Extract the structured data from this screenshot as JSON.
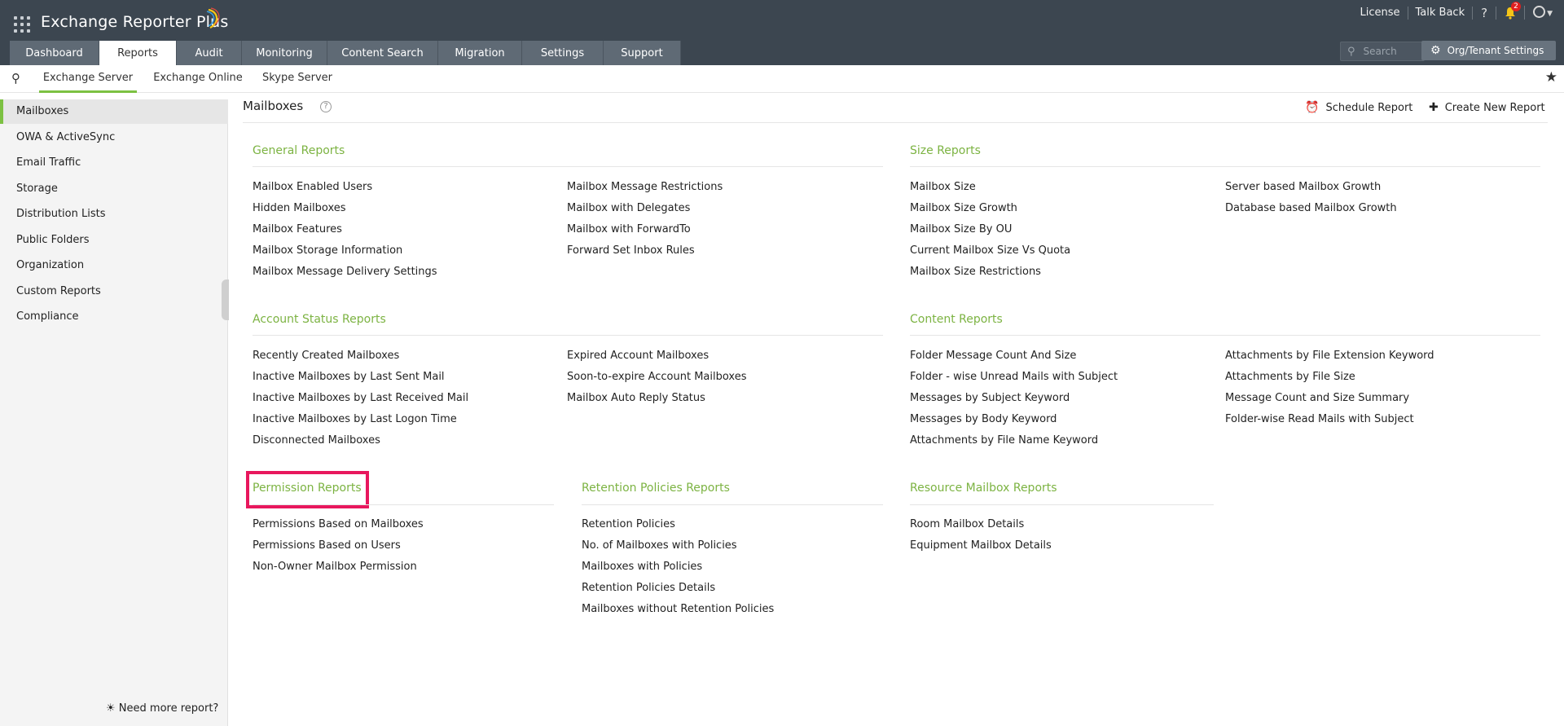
{
  "header": {
    "app_name": "Exchange Reporter Plus",
    "top_links": [
      "License",
      "Talk Back"
    ],
    "help_glyph": "?",
    "notification_count": "2",
    "tabs": [
      "Dashboard",
      "Reports",
      "Audit",
      "Monitoring",
      "Content Search",
      "Migration",
      "Settings",
      "Support"
    ],
    "active_tab": "Reports",
    "search_placeholder": "Search",
    "org_settings_label": "Org/Tenant Settings"
  },
  "subtabs": {
    "items": [
      "Exchange Server",
      "Exchange Online",
      "Skype Server"
    ],
    "active": "Exchange Server"
  },
  "sidebar": {
    "items": [
      "Mailboxes",
      "OWA & ActiveSync",
      "Email Traffic",
      "Storage",
      "Distribution Lists",
      "Public Folders",
      "Organization",
      "Custom Reports",
      "Compliance"
    ],
    "active": "Mailboxes",
    "footer": "Need more report?"
  },
  "content": {
    "title": "Mailboxes",
    "schedule_report": "Schedule Report",
    "create_new_report": "Create New Report",
    "sections": {
      "general": {
        "title": "General Reports",
        "col1": [
          "Mailbox Enabled Users",
          "Hidden Mailboxes",
          "Mailbox Features",
          "Mailbox Storage Information",
          "Mailbox Message Delivery Settings"
        ],
        "col2": [
          "Mailbox Message Restrictions",
          "Mailbox with Delegates",
          "Mailbox with ForwardTo",
          "Forward Set Inbox Rules"
        ]
      },
      "size": {
        "title": "Size Reports",
        "col1": [
          "Mailbox Size",
          "Mailbox Size Growth",
          "Mailbox Size By OU",
          "Current Mailbox Size Vs Quota",
          "Mailbox Size Restrictions"
        ],
        "col2": [
          "Server based Mailbox Growth",
          "Database based Mailbox Growth"
        ]
      },
      "account_status": {
        "title": "Account Status Reports",
        "col1": [
          "Recently Created Mailboxes",
          "Inactive Mailboxes by Last Sent Mail",
          "Inactive Mailboxes by Last Received Mail",
          "Inactive Mailboxes by Last Logon Time",
          "Disconnected Mailboxes"
        ],
        "col2": [
          "Expired Account Mailboxes",
          "Soon-to-expire Account Mailboxes",
          "Mailbox Auto Reply Status"
        ]
      },
      "content": {
        "title": "Content Reports",
        "col1": [
          "Folder Message Count And Size",
          "Folder - wise Unread Mails with Subject",
          "Messages by Subject Keyword",
          "Messages by Body Keyword",
          "Attachments by File Name Keyword"
        ],
        "col2": [
          "Attachments by File Extension Keyword",
          "Attachments by File Size",
          "Message Count and Size Summary",
          "Folder-wise Read Mails with Subject"
        ]
      },
      "permission": {
        "title": "Permission Reports",
        "col1": [
          "Permissions Based on Mailboxes",
          "Permissions Based on Users",
          "Non-Owner Mailbox Permission"
        ]
      },
      "retention": {
        "title": "Retention Policies Reports",
        "col1": [
          "Retention Policies",
          "No. of Mailboxes with Policies",
          "Mailboxes with Policies",
          "Retention Policies Details",
          "Mailboxes without Retention Policies"
        ]
      },
      "resource": {
        "title": "Resource Mailbox Reports",
        "col1": [
          "Room Mailbox Details",
          "Equipment Mailbox Details"
        ]
      }
    }
  },
  "colors": {
    "header_bg": "#3c4650",
    "accent_green": "#7cc142",
    "section_title": "#7cb342",
    "highlight_box": "#e8175d"
  }
}
